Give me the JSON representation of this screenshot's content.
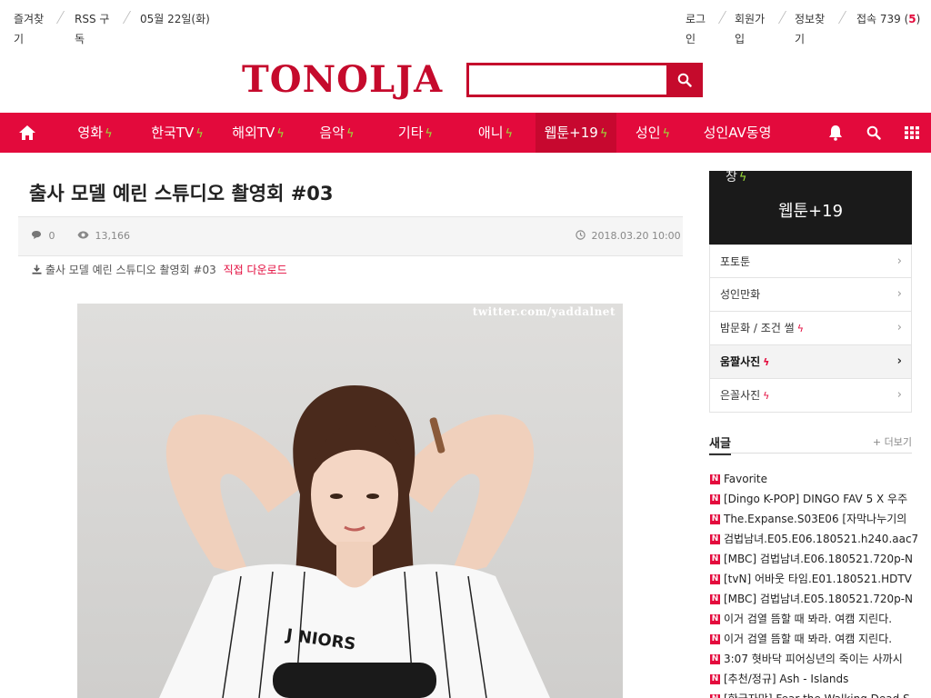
{
  "topbar": {
    "bookmark": "즐겨찾기",
    "rss": "RSS 구독",
    "date": "05월 22일(화)",
    "login": "로그인",
    "signup": "회원가입",
    "find_info": "정보찾기",
    "visitors_label": "접속 739 (",
    "visitors_count": "5",
    "visitors_close": ")"
  },
  "logo": "TONOLJA",
  "search": {
    "placeholder": ""
  },
  "nav": {
    "items": [
      {
        "label": "영화"
      },
      {
        "label": "한국TV"
      },
      {
        "label": "해외TV"
      },
      {
        "label": "음악"
      },
      {
        "label": "기타"
      },
      {
        "label": "애니"
      },
      {
        "label": "웹툰+19"
      },
      {
        "label": "성인"
      },
      {
        "label": "성인AV동영"
      }
    ],
    "bolt": "ϟ"
  },
  "post": {
    "title": "출사 모델 예린 스튜디오 촬영회 #03",
    "comments": "0",
    "views": "13,166",
    "datetime": "2018.03.20 10:00",
    "download_name": "출사 모델 예린 스튜디오 촬영회 #03",
    "download_link": "직접 다운로드",
    "watermark": "twitter.com/yaddalnet"
  },
  "sidebar": {
    "peek_label": "창",
    "header": "웹툰+19",
    "items": [
      {
        "label": "포토툰",
        "hot": ""
      },
      {
        "label": "성인만화",
        "hot": ""
      },
      {
        "label": "밤문화 / 조건 썰",
        "hot": "ϟ"
      },
      {
        "label": "움짤사진",
        "hot": "ϟ"
      },
      {
        "label": "은꼴사진",
        "hot": "ϟ"
      }
    ],
    "chevron": "›"
  },
  "new_posts": {
    "title": "새글",
    "more": "+ 더보기",
    "badge": "N",
    "items": [
      "Favorite",
      "[Dingo K-POP] DINGO FAV 5 X 우주",
      "The.Expanse.S03E06 [자막나누기의",
      "검법남녀.E05.E06.180521.h240.aac7",
      "[MBC] 검법남녀.E06.180521.720p-N",
      "[tvN] 어바웃 타임.E01.180521.HDTV",
      "[MBC] 검법남녀.E05.180521.720p-N",
      "이거 검열 뜸할 때 봐라. 여캠 지린다.",
      "이거 검열 뜸할 때 봐라. 여캠 지린다.",
      "3:07 혓바닥 피어싱년의 죽이는 사까시",
      "[추천/정규] Ash - Islands",
      "[한국자막] Fear the Walking Dead S"
    ]
  },
  "colors": {
    "brand": "#e30a3c",
    "logo": "#c50a2c",
    "bolt": "#9cdc3a"
  }
}
